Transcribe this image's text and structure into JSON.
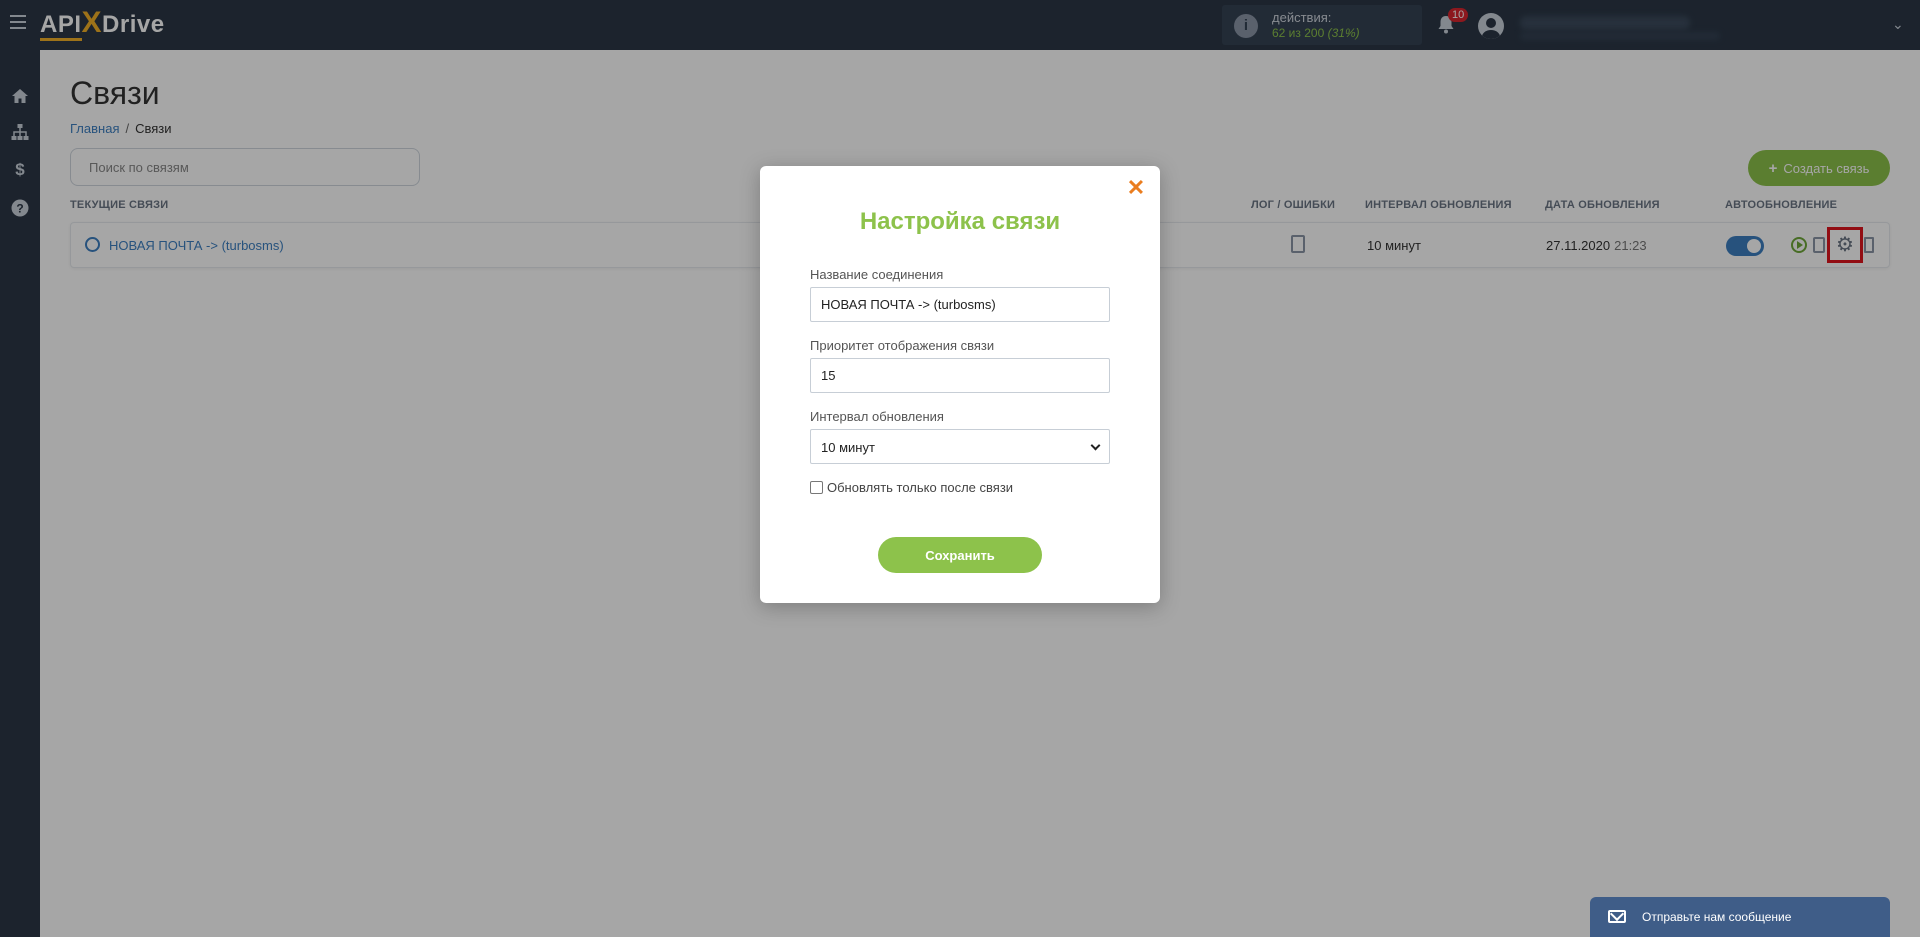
{
  "header": {
    "logo_part1": "API",
    "logo_x": "X",
    "logo_part2": "Drive",
    "actions_label": "действия:",
    "actions_used": "62 из 200",
    "actions_percent": "(31%)",
    "notifications_count": "10"
  },
  "page": {
    "title": "Связи",
    "breadcrumb_home": "Главная",
    "breadcrumb_sep": "/",
    "breadcrumb_current": "Связи",
    "search_placeholder": "Поиск по связям",
    "create_button": "Создать связь"
  },
  "table": {
    "columns": {
      "current": "ТЕКУЩИЕ СВЯЗИ",
      "log": "ЛОГ / ОШИБКИ",
      "interval": "ИНТЕРВАЛ ОБНОВЛЕНИЯ",
      "date": "ДАТА ОБНОВЛЕНИЯ",
      "auto": "АВТООБНОВЛЕНИЕ"
    },
    "rows": [
      {
        "name": "НОВАЯ ПОЧТА -> (turbosms)",
        "interval": "10 минут",
        "date": "27.11.2020",
        "time": "21:23",
        "autoupdate": true
      }
    ]
  },
  "modal": {
    "title": "Настройка связи",
    "name_label": "Название соединения",
    "name_value": "НОВАЯ ПОЧТА -> (turbosms)",
    "priority_label": "Приоритет отображения связи",
    "priority_value": "15",
    "interval_label": "Интервал обновления",
    "interval_value": "10 минут",
    "checkbox_label": "Обновлять только после связи",
    "checkbox_checked": false,
    "save_button": "Сохранить"
  },
  "chat": {
    "label": "Отправьте нам сообщение"
  },
  "colors": {
    "accent_green": "#8dc24b",
    "link_blue": "#3c7fc1",
    "sidebar": "#2b3746",
    "close_orange": "#ea7d1f",
    "highlight_red": "#e0141e"
  },
  "icons": {
    "sidebar": [
      "home-icon",
      "sitemap-icon",
      "dollar-icon",
      "help-icon"
    ]
  }
}
